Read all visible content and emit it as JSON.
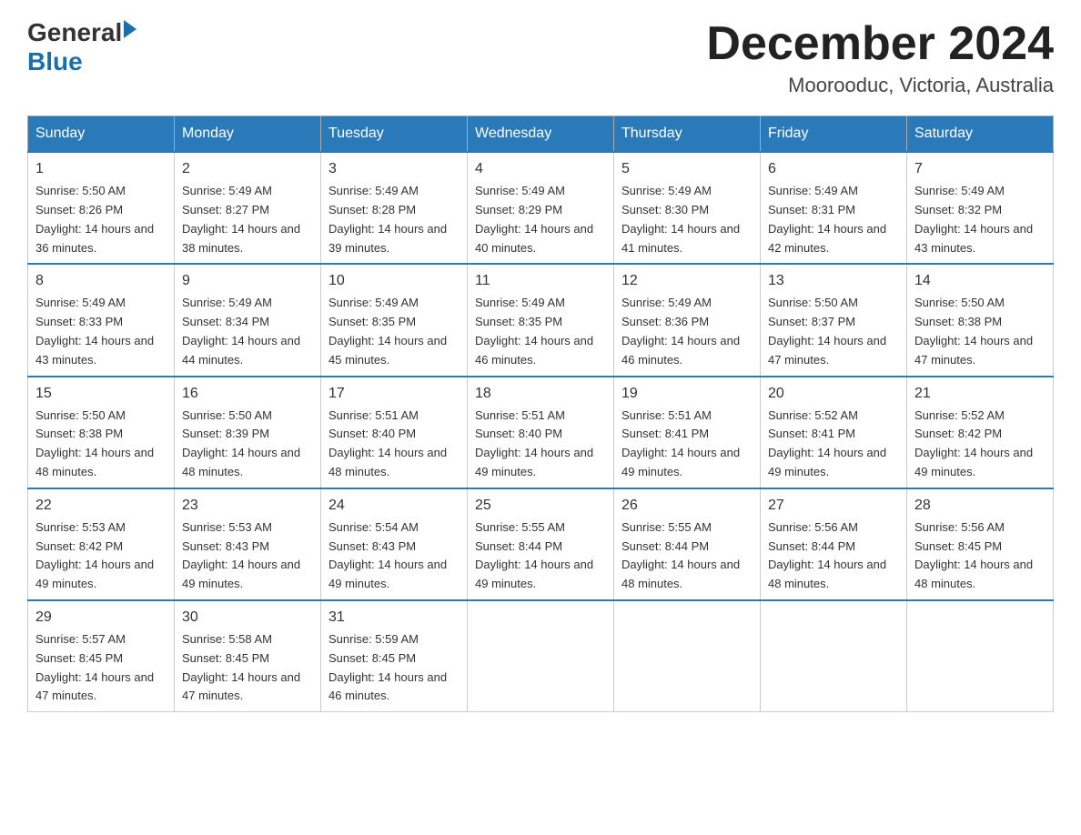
{
  "header": {
    "logo": {
      "general": "General",
      "arrow": "▶",
      "blue": "Blue"
    },
    "title": "December 2024",
    "location": "Moorooduc, Victoria, Australia"
  },
  "days_of_week": [
    "Sunday",
    "Monday",
    "Tuesday",
    "Wednesday",
    "Thursday",
    "Friday",
    "Saturday"
  ],
  "weeks": [
    [
      {
        "day": "1",
        "sunrise": "5:50 AM",
        "sunset": "8:26 PM",
        "daylight": "14 hours and 36 minutes."
      },
      {
        "day": "2",
        "sunrise": "5:49 AM",
        "sunset": "8:27 PM",
        "daylight": "14 hours and 38 minutes."
      },
      {
        "day": "3",
        "sunrise": "5:49 AM",
        "sunset": "8:28 PM",
        "daylight": "14 hours and 39 minutes."
      },
      {
        "day": "4",
        "sunrise": "5:49 AM",
        "sunset": "8:29 PM",
        "daylight": "14 hours and 40 minutes."
      },
      {
        "day": "5",
        "sunrise": "5:49 AM",
        "sunset": "8:30 PM",
        "daylight": "14 hours and 41 minutes."
      },
      {
        "day": "6",
        "sunrise": "5:49 AM",
        "sunset": "8:31 PM",
        "daylight": "14 hours and 42 minutes."
      },
      {
        "day": "7",
        "sunrise": "5:49 AM",
        "sunset": "8:32 PM",
        "daylight": "14 hours and 43 minutes."
      }
    ],
    [
      {
        "day": "8",
        "sunrise": "5:49 AM",
        "sunset": "8:33 PM",
        "daylight": "14 hours and 43 minutes."
      },
      {
        "day": "9",
        "sunrise": "5:49 AM",
        "sunset": "8:34 PM",
        "daylight": "14 hours and 44 minutes."
      },
      {
        "day": "10",
        "sunrise": "5:49 AM",
        "sunset": "8:35 PM",
        "daylight": "14 hours and 45 minutes."
      },
      {
        "day": "11",
        "sunrise": "5:49 AM",
        "sunset": "8:35 PM",
        "daylight": "14 hours and 46 minutes."
      },
      {
        "day": "12",
        "sunrise": "5:49 AM",
        "sunset": "8:36 PM",
        "daylight": "14 hours and 46 minutes."
      },
      {
        "day": "13",
        "sunrise": "5:50 AM",
        "sunset": "8:37 PM",
        "daylight": "14 hours and 47 minutes."
      },
      {
        "day": "14",
        "sunrise": "5:50 AM",
        "sunset": "8:38 PM",
        "daylight": "14 hours and 47 minutes."
      }
    ],
    [
      {
        "day": "15",
        "sunrise": "5:50 AM",
        "sunset": "8:38 PM",
        "daylight": "14 hours and 48 minutes."
      },
      {
        "day": "16",
        "sunrise": "5:50 AM",
        "sunset": "8:39 PM",
        "daylight": "14 hours and 48 minutes."
      },
      {
        "day": "17",
        "sunrise": "5:51 AM",
        "sunset": "8:40 PM",
        "daylight": "14 hours and 48 minutes."
      },
      {
        "day": "18",
        "sunrise": "5:51 AM",
        "sunset": "8:40 PM",
        "daylight": "14 hours and 49 minutes."
      },
      {
        "day": "19",
        "sunrise": "5:51 AM",
        "sunset": "8:41 PM",
        "daylight": "14 hours and 49 minutes."
      },
      {
        "day": "20",
        "sunrise": "5:52 AM",
        "sunset": "8:41 PM",
        "daylight": "14 hours and 49 minutes."
      },
      {
        "day": "21",
        "sunrise": "5:52 AM",
        "sunset": "8:42 PM",
        "daylight": "14 hours and 49 minutes."
      }
    ],
    [
      {
        "day": "22",
        "sunrise": "5:53 AM",
        "sunset": "8:42 PM",
        "daylight": "14 hours and 49 minutes."
      },
      {
        "day": "23",
        "sunrise": "5:53 AM",
        "sunset": "8:43 PM",
        "daylight": "14 hours and 49 minutes."
      },
      {
        "day": "24",
        "sunrise": "5:54 AM",
        "sunset": "8:43 PM",
        "daylight": "14 hours and 49 minutes."
      },
      {
        "day": "25",
        "sunrise": "5:55 AM",
        "sunset": "8:44 PM",
        "daylight": "14 hours and 49 minutes."
      },
      {
        "day": "26",
        "sunrise": "5:55 AM",
        "sunset": "8:44 PM",
        "daylight": "14 hours and 48 minutes."
      },
      {
        "day": "27",
        "sunrise": "5:56 AM",
        "sunset": "8:44 PM",
        "daylight": "14 hours and 48 minutes."
      },
      {
        "day": "28",
        "sunrise": "5:56 AM",
        "sunset": "8:45 PM",
        "daylight": "14 hours and 48 minutes."
      }
    ],
    [
      {
        "day": "29",
        "sunrise": "5:57 AM",
        "sunset": "8:45 PM",
        "daylight": "14 hours and 47 minutes."
      },
      {
        "day": "30",
        "sunrise": "5:58 AM",
        "sunset": "8:45 PM",
        "daylight": "14 hours and 47 minutes."
      },
      {
        "day": "31",
        "sunrise": "5:59 AM",
        "sunset": "8:45 PM",
        "daylight": "14 hours and 46 minutes."
      },
      null,
      null,
      null,
      null
    ]
  ]
}
